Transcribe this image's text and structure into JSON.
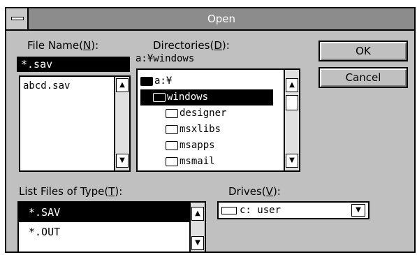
{
  "title": "Open",
  "file_name": {
    "label_pre": "File Name(",
    "label_key": "N",
    "label_post": "):",
    "value": "*.sav",
    "files": [
      "abcd.sav"
    ]
  },
  "directories": {
    "label_pre": "Directories(",
    "label_key": "D",
    "label_post": "):",
    "path": "a:¥windows",
    "items": [
      {
        "label": "a:¥",
        "level": 0,
        "selected": false,
        "open": true
      },
      {
        "label": "windows",
        "level": 1,
        "selected": true,
        "open": true
      },
      {
        "label": "designer",
        "level": 2,
        "selected": false,
        "open": false
      },
      {
        "label": "msxlibs",
        "level": 2,
        "selected": false,
        "open": false
      },
      {
        "label": "msapps",
        "level": 2,
        "selected": false,
        "open": false
      },
      {
        "label": "msmail",
        "level": 2,
        "selected": false,
        "open": false
      }
    ]
  },
  "buttons": {
    "ok": "OK",
    "cancel": "Cancel"
  },
  "file_type": {
    "label_pre": "List Files of Type(",
    "label_key": "T",
    "label_post": "):",
    "options": [
      "*.SAV",
      "*.OUT"
    ]
  },
  "drives": {
    "label_pre": "Drives(",
    "label_key": "V",
    "label_post": "):",
    "value": "c: user"
  },
  "icons": {
    "up": "▲",
    "down": "▼",
    "combo": "▼"
  }
}
